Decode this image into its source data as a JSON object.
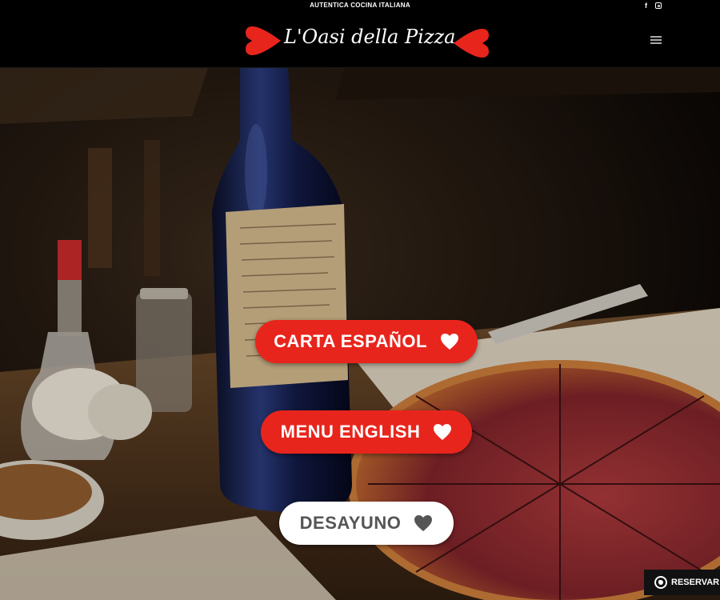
{
  "topbar": {
    "tagline": "AUTENTICA COCINA ITALIANA",
    "social": [
      {
        "icon": "facebook-icon",
        "glyph": "f"
      },
      {
        "icon": "instagram-icon"
      }
    ]
  },
  "header": {
    "logo_text": "L'Oasi della Pizza",
    "menu_icon": "hamburger-menu-icon"
  },
  "hero": {
    "buttons": [
      {
        "label": "CARTA ESPAÑOL",
        "style": "red",
        "icon": "heart-icon"
      },
      {
        "label": "MENU ENGLISH",
        "style": "red",
        "icon": "heart-icon"
      },
      {
        "label": "DESAYUNO",
        "style": "white",
        "icon": "heart-icon"
      }
    ]
  },
  "whatsapp": {
    "label": "RESERVAR I",
    "icon": "whatsapp-icon"
  },
  "colors": {
    "brand_red": "#e8251c",
    "header_bg": "#000000",
    "button_white": "#ffffff"
  }
}
